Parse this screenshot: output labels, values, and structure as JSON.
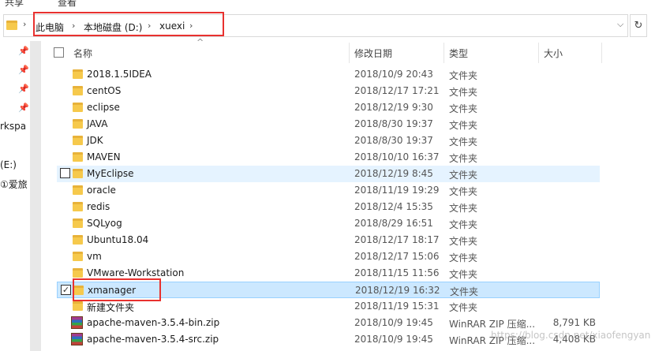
{
  "ribbon": {
    "share": "共享",
    "view": "查看"
  },
  "address_bar": {
    "crumbs": [
      "此电脑",
      "本地磁盘 (D:)",
      "xuexi"
    ],
    "separator": "›",
    "dropdown": "⌵",
    "refresh": "↻"
  },
  "nav_pane": {
    "pin_icon": "📌",
    "items": [
      "rkspa",
      "(E:)",
      "①爱旅"
    ]
  },
  "columns": {
    "name": "名称",
    "date": "修改日期",
    "type": "类型",
    "size": "大小",
    "sort_indicator": "^"
  },
  "files": [
    {
      "name": "2018.1.5IDEA",
      "date": "2018/10/9 20:43",
      "type": "文件夹",
      "size": "",
      "icon": "folder-icon"
    },
    {
      "name": "centOS",
      "date": "2018/12/17 17:21",
      "type": "文件夹",
      "size": "",
      "icon": "folder-icon"
    },
    {
      "name": "eclipse",
      "date": "2018/12/19 9:30",
      "type": "文件夹",
      "size": "",
      "icon": "folder-icon"
    },
    {
      "name": "JAVA",
      "date": "2018/8/30 19:37",
      "type": "文件夹",
      "size": "",
      "icon": "folder-icon"
    },
    {
      "name": "JDK",
      "date": "2018/8/30 19:37",
      "type": "文件夹",
      "size": "",
      "icon": "folder-icon"
    },
    {
      "name": "MAVEN",
      "date": "2018/10/10 16:37",
      "type": "文件夹",
      "size": "",
      "icon": "folder-icon"
    },
    {
      "name": "MyEclipse",
      "date": "2018/12/19 8:45",
      "type": "文件夹",
      "size": "",
      "icon": "folder-icon",
      "state": "hover"
    },
    {
      "name": "oracle",
      "date": "2018/11/19 19:29",
      "type": "文件夹",
      "size": "",
      "icon": "folder-icon"
    },
    {
      "name": "redis",
      "date": "2018/12/4 15:35",
      "type": "文件夹",
      "size": "",
      "icon": "folder-icon"
    },
    {
      "name": "SQLyog",
      "date": "2018/8/29 16:51",
      "type": "文件夹",
      "size": "",
      "icon": "folder-icon"
    },
    {
      "name": "Ubuntu18.04",
      "date": "2018/12/17 18:17",
      "type": "文件夹",
      "size": "",
      "icon": "folder-icon"
    },
    {
      "name": "vm",
      "date": "2018/12/17 15:06",
      "type": "文件夹",
      "size": "",
      "icon": "folder-icon"
    },
    {
      "name": "VMware-Workstation",
      "date": "2018/11/15 11:56",
      "type": "文件夹",
      "size": "",
      "icon": "folder-icon"
    },
    {
      "name": "xmanager",
      "date": "2018/12/19 16:32",
      "type": "文件夹",
      "size": "",
      "icon": "folder-icon",
      "state": "selected"
    },
    {
      "name": "新建文件夹",
      "date": "2018/11/19 15:31",
      "type": "文件夹",
      "size": "",
      "icon": "folder-icon"
    },
    {
      "name": "apache-maven-3.5.4-bin.zip",
      "date": "2018/10/9 19:45",
      "type": "WinRAR ZIP 压缩...",
      "size": "8,791 KB",
      "icon": "winrar-zip-icon"
    },
    {
      "name": "apache-maven-3.5.4-src.zip",
      "date": "2018/10/9 19:45",
      "type": "WinRAR ZIP 压缩...",
      "size": "4,408 KB",
      "icon": "winrar-zip-icon"
    }
  ],
  "watermark": "https://blog.csdn.net/xiaofengyan",
  "colors": {
    "highlight": "#e8312f",
    "selected_bg": "#cce8ff",
    "hover_bg": "#e5f3ff",
    "folder": "#f6c94c"
  }
}
